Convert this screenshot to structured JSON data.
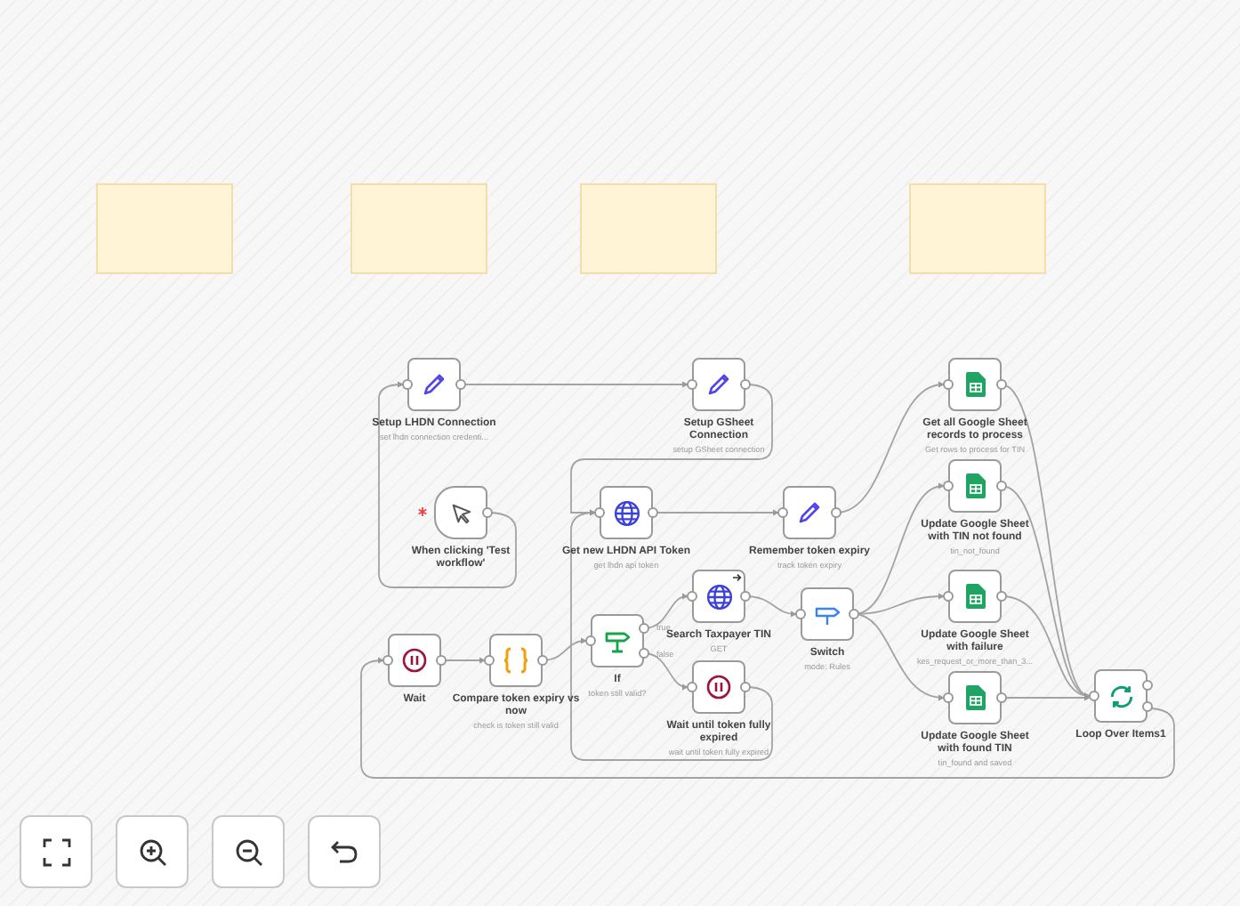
{
  "sticky_notes": [
    {
      "kind": "note"
    },
    {
      "kind": "note"
    },
    {
      "kind": "note"
    },
    {
      "kind": "note"
    }
  ],
  "nodes": [
    {
      "label": "Setup LHDN Connection",
      "subtitle": "set lhdn connection credenti...",
      "kind": "set"
    },
    {
      "label": "Setup GSheet Connection",
      "subtitle": "setup GSheet connection",
      "kind": "set"
    },
    {
      "label": "Get all Google Sheet records to process",
      "subtitle": "Get rows to process for TIN",
      "kind": "sheets"
    },
    {
      "label": "When clicking 'Test workflow'",
      "kind": "trigger"
    },
    {
      "label": "Get new LHDN API Token",
      "subtitle": "get lhdn api token",
      "kind": "http"
    },
    {
      "label": "Remember token expiry",
      "subtitle": "track token expiry",
      "kind": "set"
    },
    {
      "label": "Update Google Sheet with TIN not found",
      "subtitle": "tin_not_found",
      "kind": "sheets"
    },
    {
      "label": "Search Taxpayer TIN",
      "subtitle": "GET",
      "kind": "http",
      "pinned": true
    },
    {
      "label": "Update Google Sheet with failure",
      "subtitle": "kes_request_or_more_than_3...",
      "kind": "sheets"
    },
    {
      "label": "Wait",
      "kind": "wait"
    },
    {
      "label": "Compare token expiry vs now",
      "subtitle": "check is token still valid",
      "kind": "code"
    },
    {
      "label": "If",
      "subtitle": "token still valid?",
      "kind": "if",
      "outputs": [
        "true",
        "false"
      ]
    },
    {
      "label": "Switch",
      "subtitle": "mode: Rules",
      "kind": "switch"
    },
    {
      "label": "Wait until token fully expired",
      "subtitle": "wait until token fully expired",
      "kind": "wait"
    },
    {
      "label": "Update Google Sheet with found TIN",
      "subtitle": "tin_found and saved",
      "kind": "sheets"
    },
    {
      "label": "Loop Over Items1",
      "kind": "loop"
    }
  ],
  "controls": [
    {
      "kind": "fit"
    },
    {
      "kind": "zoom_in"
    },
    {
      "kind": "zoom_out"
    },
    {
      "kind": "undo"
    }
  ]
}
